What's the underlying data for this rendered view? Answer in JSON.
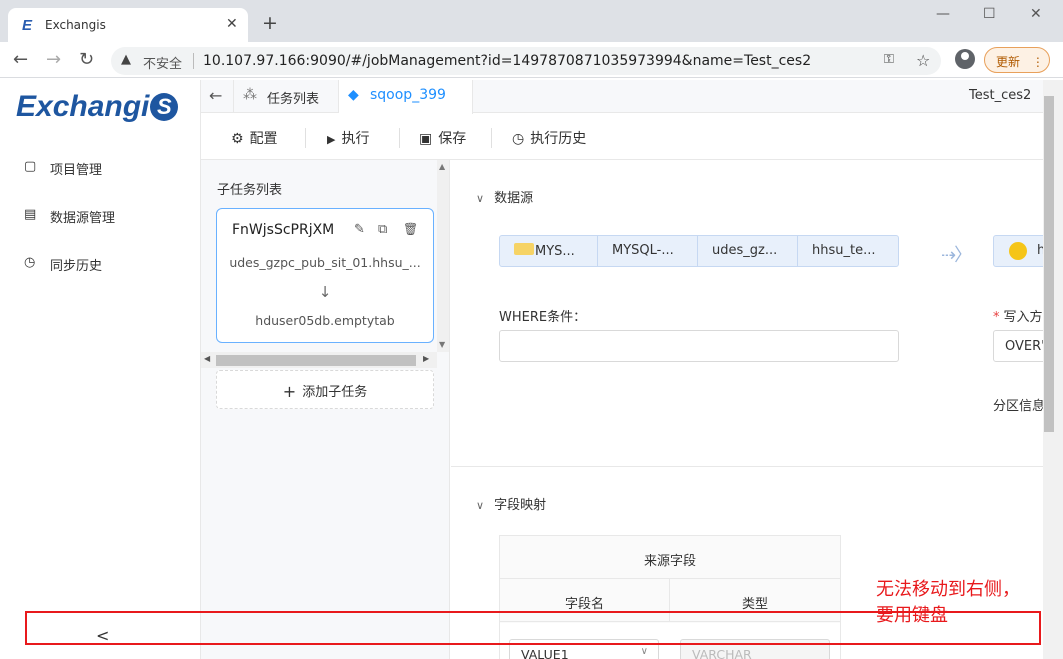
{
  "browser": {
    "tab_title": "Exchangis",
    "favicon": "E",
    "close_glyph": "✕",
    "new_tab_glyph": "+",
    "window_minimize": "—",
    "window_maximize": "☐",
    "window_close": "✕",
    "back_glyph": "←",
    "forward_glyph": "→",
    "reload_glyph": "↻",
    "warn_glyph": "▲",
    "security_text": "不安全",
    "url": "10.107.97.166:9090/#/jobManagement?id=1497870871035973994&name=Test_ces2",
    "key_glyph": "⚿",
    "star_glyph": "☆",
    "update_label": "更新",
    "update_menu": "⋮"
  },
  "app": {
    "logo_text": "Exchangi",
    "logo_tail": "S",
    "sidebar": {
      "items": [
        {
          "icon": "▢",
          "label": "项目管理"
        },
        {
          "icon": "▤",
          "label": "数据源管理"
        },
        {
          "icon": "◷",
          "label": "同步历史"
        }
      ],
      "collapse_glyph": "<"
    },
    "tabs": {
      "back_glyph": "←",
      "list_icon": "⁂",
      "list_label": "任务列表",
      "active_icon": "◆",
      "active_label": "sqoop_399"
    },
    "job_name": "Test_ces2",
    "toolbar": {
      "config_icon": "⚙",
      "config_label": "配置",
      "run_icon": "▶",
      "run_label": "执行",
      "save_icon": "▣",
      "save_label": "保存",
      "history_icon": "◷",
      "history_label": "执行历史"
    },
    "subtasks": {
      "title": "子任务列表",
      "card": {
        "name": "FnWjsScPRjXM",
        "edit_glyph": "✎",
        "copy_glyph": "⧉",
        "delete_glyph": "🗑",
        "source": "udes_gzpc_pub_sit_01.hhsu_...",
        "arrow_glyph": "↓",
        "target": "hduser05db.emptytab"
      },
      "scroll_up": "▲",
      "scroll_down": "▼",
      "scroll_left": "◀",
      "scroll_right": "▶",
      "add_glyph": "+",
      "add_label": "添加子任务"
    },
    "datasource": {
      "section_chevron": "∨",
      "section_title": "数据源",
      "source_segments": [
        "MYS...",
        "MYSQL-...",
        "udes_gz...",
        "hhsu_te..."
      ],
      "flow_arrow": "⇢〉",
      "target_first_char": "h",
      "where_label": "WHERE条件：",
      "where_value": "",
      "write_required_mark": "*",
      "write_label": "写入方",
      "write_value": "OVER'",
      "partition_label": "分区信息"
    },
    "mapping": {
      "section_chevron": "∨",
      "section_title": "字段映射",
      "source_header": "来源字段",
      "col_name": "字段名",
      "col_type": "类型",
      "row_value": "VALUE1",
      "row_dropdown": "∨",
      "row_type": "VARCHAR"
    }
  },
  "annotation": {
    "line1": "无法移动到右侧，",
    "line2": "要用键盘"
  },
  "colors": {
    "accent": "#1e8fff",
    "annotation_red": "#e8191c",
    "logo_blue": "#1e56a0"
  }
}
